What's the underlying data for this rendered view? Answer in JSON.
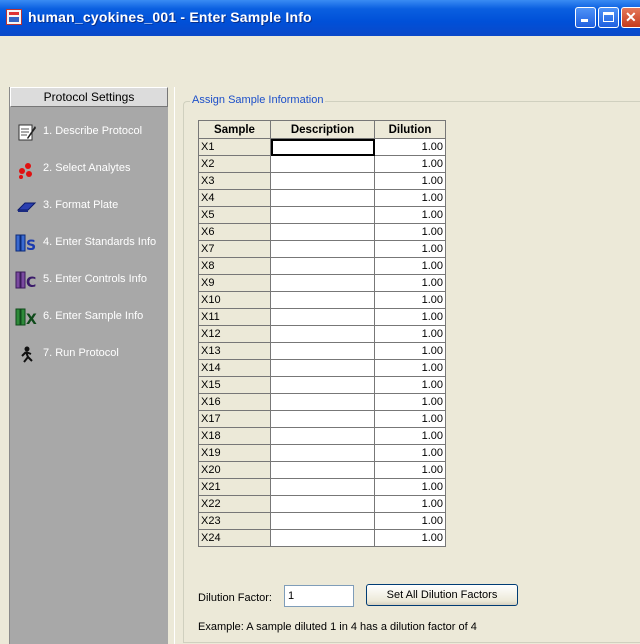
{
  "window": {
    "title": "human_cyokines_001 - Enter Sample Info"
  },
  "sidebar": {
    "header": "Protocol Settings",
    "steps": [
      {
        "label": "1. Describe Protocol",
        "icon": "describe-protocol-icon"
      },
      {
        "label": "2. Select Analytes",
        "icon": "select-analytes-icon"
      },
      {
        "label": "3. Format Plate",
        "icon": "format-plate-icon"
      },
      {
        "label": "4. Enter Standards Info",
        "icon": "standards-icon"
      },
      {
        "label": "5. Enter Controls Info",
        "icon": "controls-icon"
      },
      {
        "label": "6. Enter Sample Info",
        "icon": "sample-icon"
      },
      {
        "label": "7. Run Protocol",
        "icon": "run-protocol-icon"
      }
    ]
  },
  "main": {
    "group_title": "Assign Sample Information",
    "table": {
      "headers": [
        "Sample",
        "Description",
        "Dilution"
      ],
      "rows": [
        [
          "X1",
          "",
          "1.00"
        ],
        [
          "X2",
          "",
          "1.00"
        ],
        [
          "X3",
          "",
          "1.00"
        ],
        [
          "X4",
          "",
          "1.00"
        ],
        [
          "X5",
          "",
          "1.00"
        ],
        [
          "X6",
          "",
          "1.00"
        ],
        [
          "X7",
          "",
          "1.00"
        ],
        [
          "X8",
          "",
          "1.00"
        ],
        [
          "X9",
          "",
          "1.00"
        ],
        [
          "X10",
          "",
          "1.00"
        ],
        [
          "X11",
          "",
          "1.00"
        ],
        [
          "X12",
          "",
          "1.00"
        ],
        [
          "X13",
          "",
          "1.00"
        ],
        [
          "X14",
          "",
          "1.00"
        ],
        [
          "X15",
          "",
          "1.00"
        ],
        [
          "X16",
          "",
          "1.00"
        ],
        [
          "X17",
          "",
          "1.00"
        ],
        [
          "X18",
          "",
          "1.00"
        ],
        [
          "X19",
          "",
          "1.00"
        ],
        [
          "X20",
          "",
          "1.00"
        ],
        [
          "X21",
          "",
          "1.00"
        ],
        [
          "X22",
          "",
          "1.00"
        ],
        [
          "X23",
          "",
          "1.00"
        ],
        [
          "X24",
          "",
          "1.00"
        ]
      ]
    },
    "dilution_factor_label": "Dilution Factor:",
    "dilution_factor_value": "1",
    "set_all_button": "Set All Dilution Factors",
    "example_text": "Example: A sample diluted 1 in 4 has a dilution factor of 4"
  }
}
